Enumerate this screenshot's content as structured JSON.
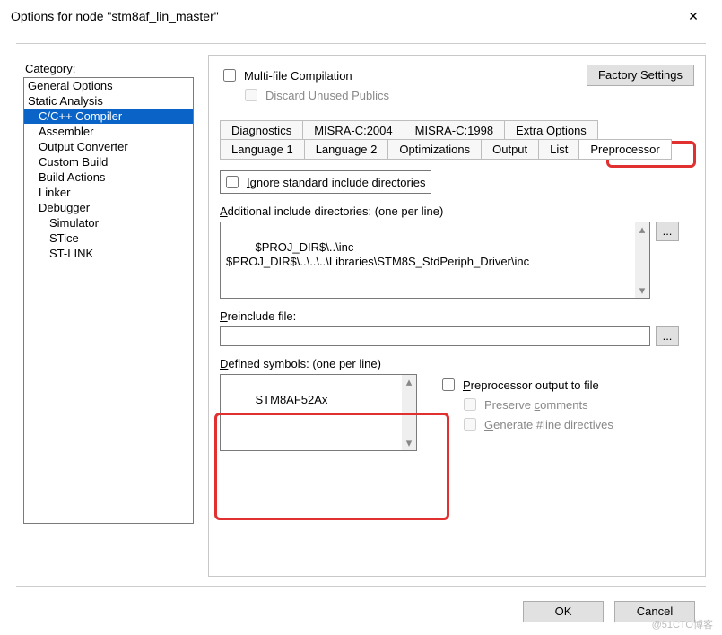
{
  "window": {
    "title": "Options for node \"stm8af_lin_master\""
  },
  "category": {
    "label": "Category:",
    "items": [
      {
        "label": "General Options",
        "indent": 0,
        "selected": false
      },
      {
        "label": "Static Analysis",
        "indent": 0,
        "selected": false
      },
      {
        "label": "C/C++ Compiler",
        "indent": 1,
        "selected": true
      },
      {
        "label": "Assembler",
        "indent": 1,
        "selected": false
      },
      {
        "label": "Output Converter",
        "indent": 1,
        "selected": false
      },
      {
        "label": "Custom Build",
        "indent": 1,
        "selected": false
      },
      {
        "label": "Build Actions",
        "indent": 1,
        "selected": false
      },
      {
        "label": "Linker",
        "indent": 1,
        "selected": false
      },
      {
        "label": "Debugger",
        "indent": 1,
        "selected": false
      },
      {
        "label": "Simulator",
        "indent": 2,
        "selected": false
      },
      {
        "label": "STice",
        "indent": 2,
        "selected": false
      },
      {
        "label": "ST-LINK",
        "indent": 2,
        "selected": false
      }
    ]
  },
  "right": {
    "factory": "Factory Settings",
    "multifile": "Multi-file Compilation",
    "discard": "Discard Unused Publics",
    "tabs_top": [
      "Diagnostics",
      "MISRA-C:2004",
      "MISRA-C:1998",
      "Extra Options"
    ],
    "tabs_bot": [
      "Language 1",
      "Language 2",
      "Optimizations",
      "Output",
      "List",
      "Preprocessor"
    ],
    "ignore_label": "Ignore standard include directories",
    "addl_label": "Additional include directories: (one per line)",
    "addl_value": "$PROJ_DIR$\\..\\inc\n$PROJ_DIR$\\..\\..\\..\\Libraries\\STM8S_StdPeriph_Driver\\inc",
    "preinc_label": "Preinclude file:",
    "preinc_value": "",
    "def_label": "Defined symbols: (one per line)",
    "def_value": "STM8AF52Ax",
    "pp_out": "Preprocessor output to file",
    "pp_preserve": "Preserve comments",
    "pp_gen": "Generate #line directives",
    "browse": "..."
  },
  "buttons": {
    "ok": "OK",
    "cancel": "Cancel"
  },
  "watermark": "@51CTO博客"
}
